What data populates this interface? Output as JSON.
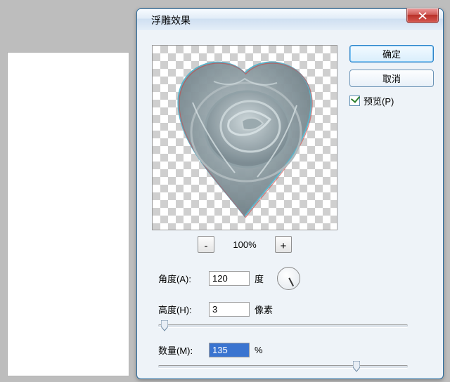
{
  "dialog": {
    "title": "浮雕效果"
  },
  "buttons": {
    "ok": "确定",
    "cancel": "取消",
    "preview": "预览(P)"
  },
  "zoom": {
    "minus": "-",
    "plus": "+",
    "value": "100%"
  },
  "params": {
    "angle": {
      "label": "角度(A):",
      "value": "120",
      "unit": "度"
    },
    "height": {
      "label": "高度(H):",
      "value": "3",
      "unit": "像素"
    },
    "amount": {
      "label": "数量(M):",
      "value": "135",
      "unit": "%"
    }
  },
  "preview_checked": true,
  "colors": {
    "accent": "#2f84c8",
    "close": "#c0392b",
    "selection": "#3a74d0"
  }
}
